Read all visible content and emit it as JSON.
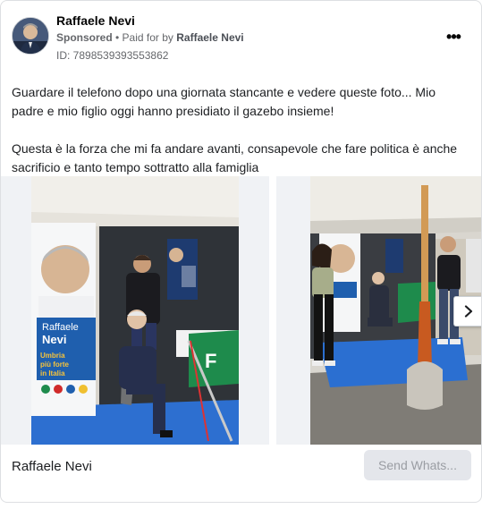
{
  "post": {
    "page_name": "Raffaele Nevi",
    "sponsored_label": "Sponsored",
    "paid_for_prefix": " • Paid for by ",
    "paid_for_name": "Raffaele Nevi",
    "id_label": "ID: 7898539393553862",
    "more_icon": "•••",
    "paragraphs": [
      "Guardare il telefono dopo una giornata stancante e vedere queste foto... Mio padre e mio figlio oggi hanno presidiato il gazebo insieme!",
      "Questa è la forza che mi fa andare avanti, consapevole che fare politica è anche sacrificio e tanto tempo sottratto alla famiglia"
    ]
  },
  "poster": {
    "line1": "Raffaele",
    "line2": "Nevi",
    "slogan1": "Umbria",
    "slogan2": "più forte",
    "slogan3": "in Italia"
  },
  "footer": {
    "name": "Raffaele Nevi",
    "cta_label": "Send Whats..."
  },
  "colors": {
    "brand_blue": "#1f5fae",
    "party_green": "#1e8b4c",
    "party_red": "#d02a2a",
    "carpet_blue": "#2b6fd1"
  }
}
